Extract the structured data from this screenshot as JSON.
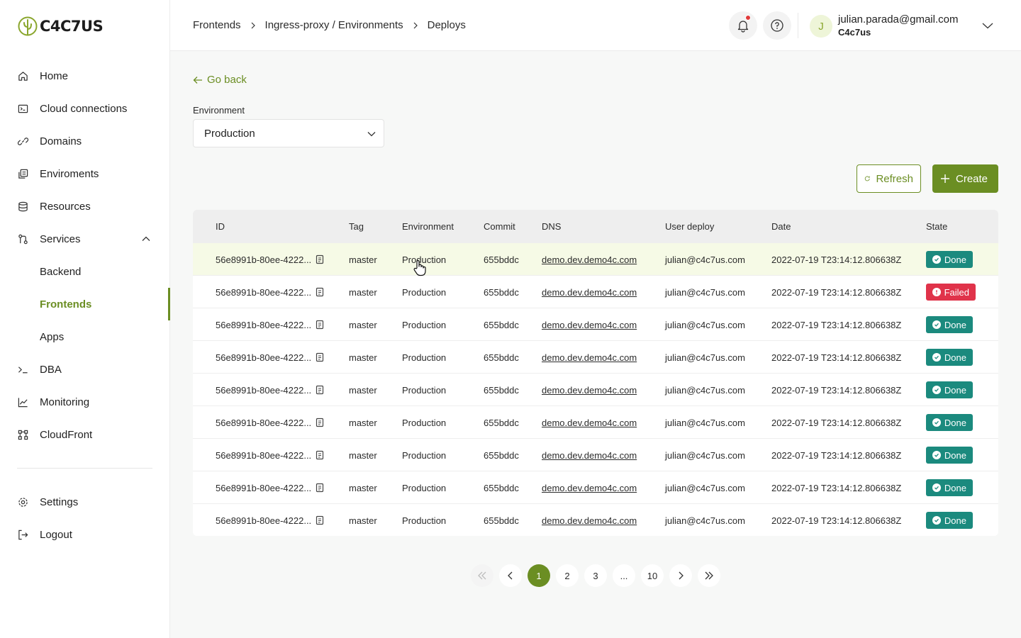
{
  "brand": {
    "name": "C4C7US"
  },
  "sidebar": {
    "items": [
      {
        "label": "Home",
        "icon": "home-icon"
      },
      {
        "label": "Cloud connections",
        "icon": "terminal-box-icon"
      },
      {
        "label": "Domains",
        "icon": "link-icon"
      },
      {
        "label": "Enviroments",
        "icon": "environments-icon"
      },
      {
        "label": "Resources",
        "icon": "database-icon"
      },
      {
        "label": "Services",
        "icon": "services-icon",
        "expanded": true
      },
      {
        "label": "Backend",
        "sub": true
      },
      {
        "label": "Frontends",
        "sub": true,
        "active": true
      },
      {
        "label": "Apps",
        "sub": true
      },
      {
        "label": "DBA",
        "icon": "prompt-icon"
      },
      {
        "label": "Monitoring",
        "icon": "chart-icon"
      },
      {
        "label": "CloudFront",
        "icon": "nodes-icon"
      }
    ],
    "bottom": [
      {
        "label": "Settings",
        "icon": "gear-icon"
      },
      {
        "label": "Logout",
        "icon": "logout-icon"
      }
    ]
  },
  "breadcrumbs": [
    "Frontends",
    "Ingress-proxy / Environments",
    "Deploys"
  ],
  "user": {
    "initial": "J",
    "email": "julian.parada@gmail.com",
    "org": "C4c7us"
  },
  "main": {
    "go_back": "Go back",
    "environment_label": "Environment",
    "environment_value": "Production",
    "refresh_label": "Refresh",
    "create_label": "Create"
  },
  "table": {
    "headers": [
      "ID",
      "Tag",
      "Environment",
      "Commit",
      "DNS",
      "User deploy",
      "Date",
      "State"
    ],
    "rows": [
      {
        "id": "56e8991b-80ee-4222...",
        "tag": "master",
        "env": "Production",
        "commit": "655bddc",
        "dns": "demo.dev.demo4c.com",
        "user": "julian@c4c7us.com",
        "date": "2022-07-19 T23:14:12.806638Z",
        "state": "Done"
      },
      {
        "id": "56e8991b-80ee-4222...",
        "tag": "master",
        "env": "Production",
        "commit": "655bddc",
        "dns": "demo.dev.demo4c.com",
        "user": "julian@c4c7us.com",
        "date": "2022-07-19 T23:14:12.806638Z",
        "state": "Failed"
      },
      {
        "id": "56e8991b-80ee-4222...",
        "tag": "master",
        "env": "Production",
        "commit": "655bddc",
        "dns": "demo.dev.demo4c.com",
        "user": "julian@c4c7us.com",
        "date": "2022-07-19 T23:14:12.806638Z",
        "state": "Done"
      },
      {
        "id": "56e8991b-80ee-4222...",
        "tag": "master",
        "env": "Production",
        "commit": "655bddc",
        "dns": "demo.dev.demo4c.com",
        "user": "julian@c4c7us.com",
        "date": "2022-07-19 T23:14:12.806638Z",
        "state": "Done"
      },
      {
        "id": "56e8991b-80ee-4222...",
        "tag": "master",
        "env": "Production",
        "commit": "655bddc",
        "dns": "demo.dev.demo4c.com",
        "user": "julian@c4c7us.com",
        "date": "2022-07-19 T23:14:12.806638Z",
        "state": "Done"
      },
      {
        "id": "56e8991b-80ee-4222...",
        "tag": "master",
        "env": "Production",
        "commit": "655bddc",
        "dns": "demo.dev.demo4c.com",
        "user": "julian@c4c7us.com",
        "date": "2022-07-19 T23:14:12.806638Z",
        "state": "Done"
      },
      {
        "id": "56e8991b-80ee-4222...",
        "tag": "master",
        "env": "Production",
        "commit": "655bddc",
        "dns": "demo.dev.demo4c.com",
        "user": "julian@c4c7us.com",
        "date": "2022-07-19 T23:14:12.806638Z",
        "state": "Done"
      },
      {
        "id": "56e8991b-80ee-4222...",
        "tag": "master",
        "env": "Production",
        "commit": "655bddc",
        "dns": "demo.dev.demo4c.com",
        "user": "julian@c4c7us.com",
        "date": "2022-07-19 T23:14:12.806638Z",
        "state": "Done"
      },
      {
        "id": "56e8991b-80ee-4222...",
        "tag": "master",
        "env": "Production",
        "commit": "655bddc",
        "dns": "demo.dev.demo4c.com",
        "user": "julian@c4c7us.com",
        "date": "2022-07-19 T23:14:12.806638Z",
        "state": "Done"
      }
    ]
  },
  "pagination": {
    "pages": [
      "1",
      "2",
      "3",
      "...",
      "10"
    ],
    "current": "1"
  },
  "colors": {
    "accent": "#6b8e23",
    "done": "#1b8a7e",
    "failed": "#e0334a",
    "hover_row": "#f6fae6"
  }
}
